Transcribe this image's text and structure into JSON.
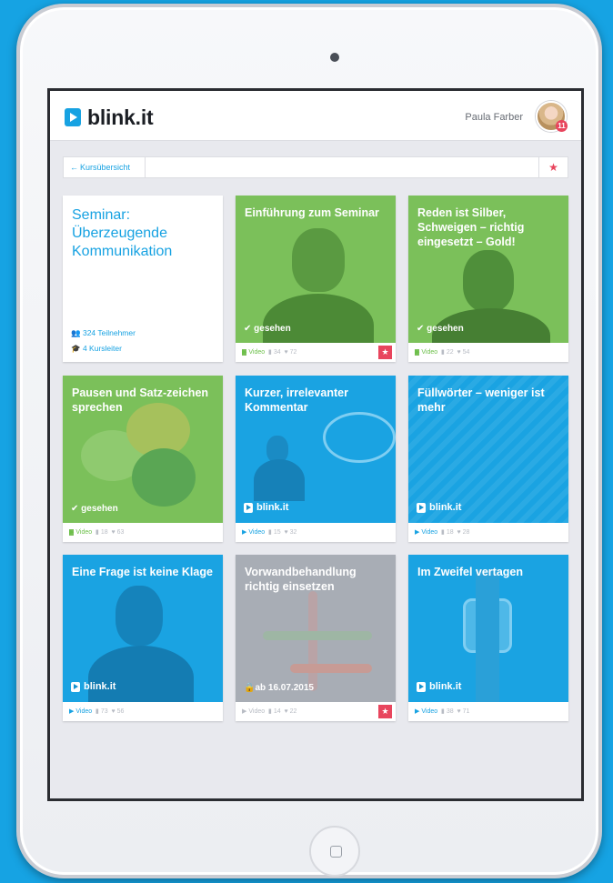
{
  "app": {
    "brand": "blink.it",
    "user_name": "Paula Farber",
    "avatar_badge": "11"
  },
  "breadcrumb": {
    "back_label": "Kursübersicht"
  },
  "intro": {
    "title": "Seminar: Überzeugende Kommunikation",
    "participants": "324 Teilnehmer",
    "instructors": "4 Kursleiter"
  },
  "cards": [
    {
      "title": "Einführung zum Seminar",
      "status": "✔ gesehen",
      "video": "Video",
      "comments": "34",
      "likes": "72",
      "starred": true,
      "theme": "green"
    },
    {
      "title": "Reden ist Silber, Schweigen – richtig eingesetzt – Gold!",
      "status": "✔ gesehen",
      "video": "Video",
      "comments": "22",
      "likes": "54",
      "starred": false,
      "theme": "green"
    },
    {
      "title": "Pausen und Satz-zeichen sprechen",
      "status": "✔ gesehen",
      "video": "Video",
      "comments": "18",
      "likes": "63",
      "starred": false,
      "theme": "green"
    },
    {
      "title": "Kurzer, irrelevanter Kommentar",
      "brand": "blink.it",
      "video": "Video",
      "comments": "15",
      "likes": "32",
      "starred": false,
      "theme": "blue"
    },
    {
      "title": "Füllwörter – weniger ist mehr",
      "brand": "blink.it",
      "video": "Video",
      "comments": "18",
      "likes": "28",
      "starred": false,
      "theme": "blue"
    },
    {
      "title": "Eine Frage ist keine Klage",
      "brand": "blink.it",
      "video": "Video",
      "comments": "73",
      "likes": "56",
      "starred": false,
      "theme": "blue"
    },
    {
      "title": "Vorwandbehandlung richtig einsetzen",
      "status": "ab 16.07.2015",
      "video": "Video",
      "comments": "14",
      "likes": "22",
      "starred": true,
      "theme": "gray"
    },
    {
      "title": "Im Zweifel vertagen",
      "brand": "blink.it",
      "video": "Video",
      "comments": "38",
      "likes": "71",
      "starred": false,
      "theme": "blue"
    }
  ],
  "colors": {
    "accent": "#17a2e2",
    "green": "#7bc05a",
    "star": "#e8455d"
  },
  "icons": {
    "back": "arrow-left-icon",
    "star": "star-icon",
    "participants": "users-icon",
    "instructors": "graduation-cap-icon",
    "play": "play-icon",
    "comment": "comment-icon",
    "heart": "heart-icon",
    "check": "check-icon",
    "lock": "lock-icon"
  }
}
